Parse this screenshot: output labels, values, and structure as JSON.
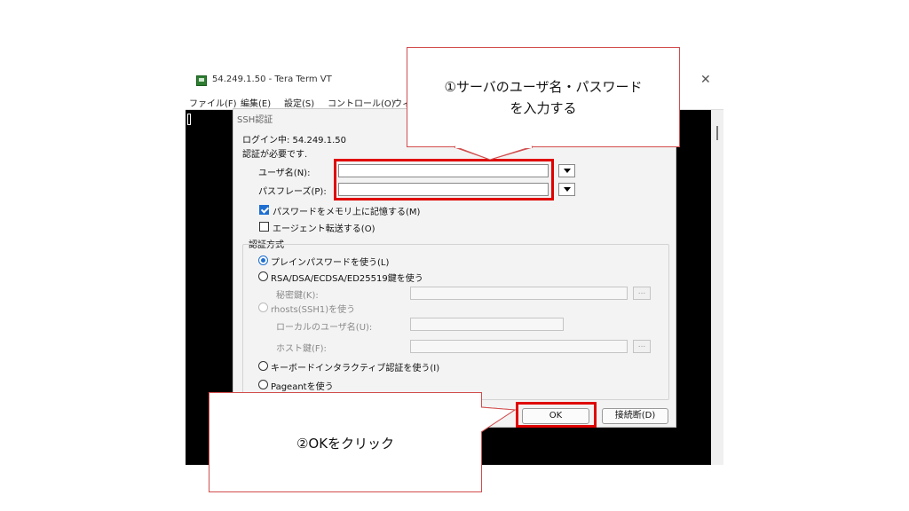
{
  "window": {
    "title": "54.249.1.50 - Tera Term VT",
    "close_glyph": "✕",
    "menu": [
      "ファイル(F)",
      "編集(E)",
      "設定(S)",
      "コントロール(O)",
      "ウィ"
    ]
  },
  "dialog": {
    "title": "SSH認証",
    "login_status": "ログイン中: 54.249.1.50",
    "auth_required": "認証が必要です.",
    "username_label": "ユーザ名(N):",
    "username_value": "",
    "passphrase_label": "パスフレーズ(P):",
    "passphrase_value": "",
    "remember_password_label": "パスワードをメモリ上に記憶する(M)",
    "remember_password_checked": true,
    "agent_forward_label": "エージェント転送する(O)",
    "agent_forward_checked": false,
    "auth_method_title": "認証方式",
    "methods": {
      "plain_password": "プレインパスワードを使う(L)",
      "rsa_key": "RSA/DSA/ECDSA/ED25519鍵を使う",
      "private_key_label": "秘密鍵(K):",
      "rhosts": "rhosts(SSH1)を使う",
      "local_user_label": "ローカルのユーザ名(U):",
      "host_key_label": "ホスト鍵(F):",
      "keyboard_interactive": "キーボードインタラクティブ認証を使う(I)",
      "pageant": "Pageantを使う"
    },
    "browse_label": "...",
    "ok_label": "OK",
    "disconnect_label": "接続断(D)"
  },
  "callouts": {
    "step1_line1": "①サーバのユーザ名・パスワード",
    "step1_line2": "を入力する",
    "step2": "②OKをクリック"
  },
  "colors": {
    "highlight_red": "#e00000",
    "callout_border": "#d24d4d",
    "accent_blue": "#1f6fd1"
  }
}
